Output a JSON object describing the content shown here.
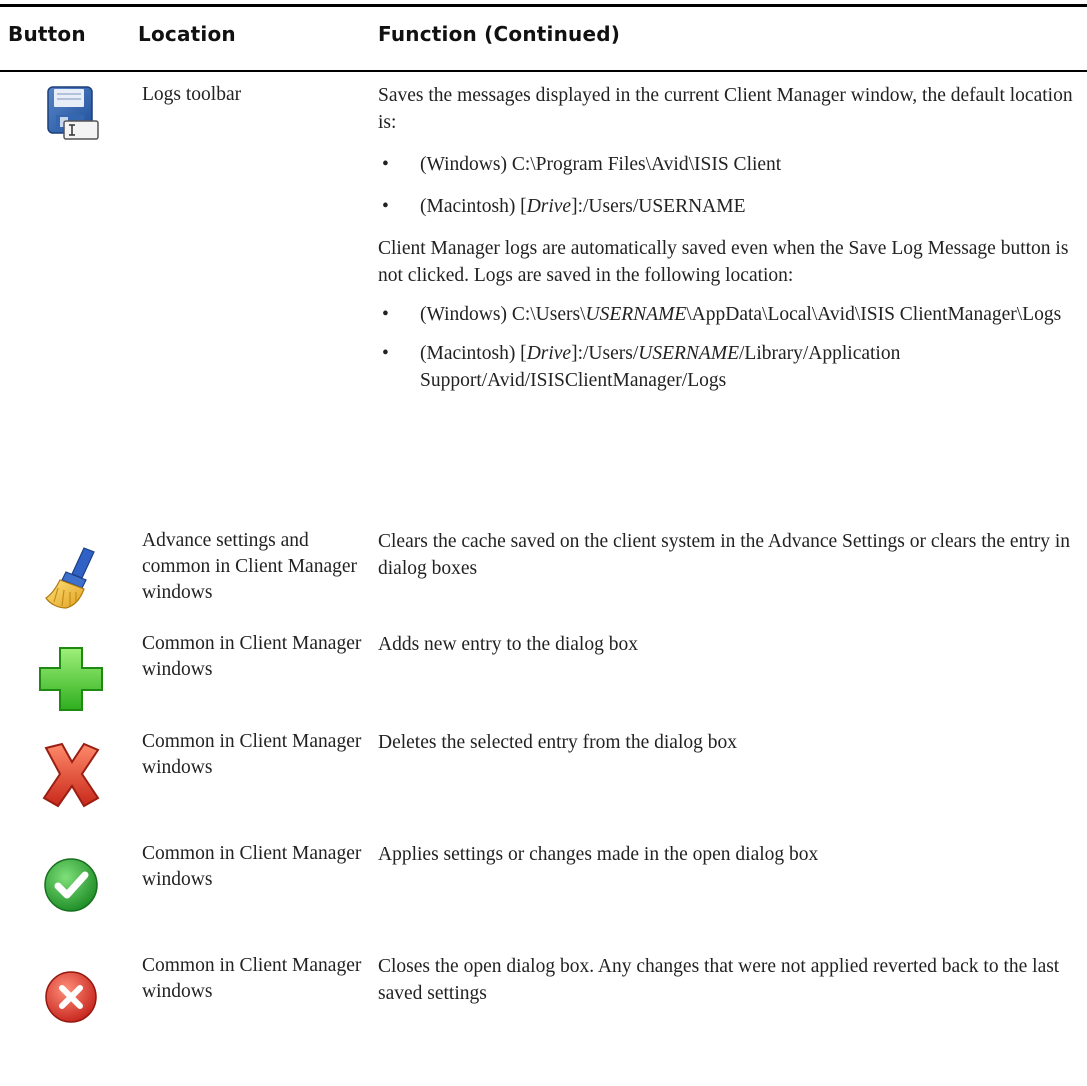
{
  "header": {
    "button": "Button",
    "location": "Location",
    "function": "Function (Continued)"
  },
  "rows": [
    {
      "icon": "save-disk-icon",
      "location": "Logs toolbar",
      "lines": {
        "intro": "Saves the messages displayed in the current Client Manager window, the default location is:",
        "b1": "(Windows) C:\\Program Files\\Avid\\ISIS Client",
        "b2_pre": "(Macintosh) [",
        "b2_em": "Drive",
        "b2_post": "]:/Users/USERNAME",
        "para": "Client Manager logs are automatically saved even when the Save Log Message button is not clicked. Logs are saved in the following location:",
        "b3_pre": "(Windows) C:\\Users\\",
        "b3_em": "USERNAME",
        "b3_post": "\\AppData\\Local\\Avid\\ISIS ClientManager\\Logs",
        "b4_pre": "(Macintosh) [",
        "b4_em1": "Drive",
        "b4_mid": "]:/Users/",
        "b4_em2": "USERNAME",
        "b4_post": "/Library/Application Support/Avid/ISISClientManager/Logs"
      }
    },
    {
      "icon": "broom-clear-icon",
      "location": "Advance settings and common in Client Manager windows",
      "function": "Clears the cache saved on the client system in the Advance Settings or clears the entry in dialog boxes"
    },
    {
      "icon": "green-plus-icon",
      "location": "Common in Client Manager windows",
      "function": "Adds new entry to the dialog box"
    },
    {
      "icon": "red-x-icon",
      "location": "Common in Client Manager windows",
      "function": "Deletes the selected entry from the dialog box"
    },
    {
      "icon": "green-check-icon",
      "location": "Common in Client Manager windows",
      "function": "Applies settings or changes made in the open dialog box"
    },
    {
      "icon": "red-close-circle-icon",
      "location": "Common in Client Manager windows",
      "function": "Closes the open dialog box. Any changes that were not applied reverted back to the last saved settings"
    }
  ],
  "bullet_char": "•"
}
